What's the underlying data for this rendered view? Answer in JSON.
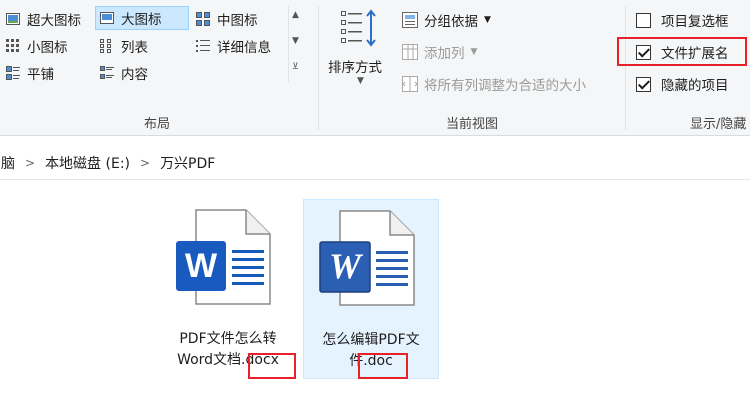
{
  "ribbon": {
    "layout": {
      "label": "布局",
      "items": [
        {
          "label": "超大图标",
          "icon": "extra-large-icons-icon"
        },
        {
          "label": "大图标",
          "icon": "large-icons-icon",
          "selected": true
        },
        {
          "label": "中图标",
          "icon": "medium-icons-icon"
        },
        {
          "label": "小图标",
          "icon": "small-icons-icon"
        },
        {
          "label": "列表",
          "icon": "list-icon"
        },
        {
          "label": "详细信息",
          "icon": "details-icon"
        },
        {
          "label": "平铺",
          "icon": "tiles-icon"
        },
        {
          "label": "内容",
          "icon": "content-icon"
        }
      ]
    },
    "current_view": {
      "label": "当前视图",
      "sort_label": "排序方式",
      "group_by": "分组依据",
      "add_column": "添加列",
      "size_columns": "将所有列调整为合适的大小"
    },
    "show_hide": {
      "label": "显示/隐藏",
      "item_checkboxes": {
        "label": "项目复选框",
        "checked": false
      },
      "file_extensions": {
        "label": "文件扩展名",
        "checked": true
      },
      "hidden_items": {
        "label": "隐藏的项目",
        "checked": true
      }
    }
  },
  "address": {
    "crumbs": [
      "脑",
      "本地磁盘 (E:)",
      "万兴PDF"
    ]
  },
  "files": [
    {
      "name_line1": "PDF文件怎么转",
      "name_line2": "Word文档",
      "ext": ".docx",
      "icon": "word-modern-icon"
    },
    {
      "name_line1": "怎么编辑PDF文",
      "name_line2": "件",
      "ext": ".doc",
      "icon": "word-legacy-icon",
      "selected": true
    }
  ],
  "colors": {
    "accent_red": "#e8202a",
    "word_blue_modern": "#185abd",
    "word_blue_legacy": "#2b5fb4",
    "selection_bg": "#cce8ff"
  }
}
